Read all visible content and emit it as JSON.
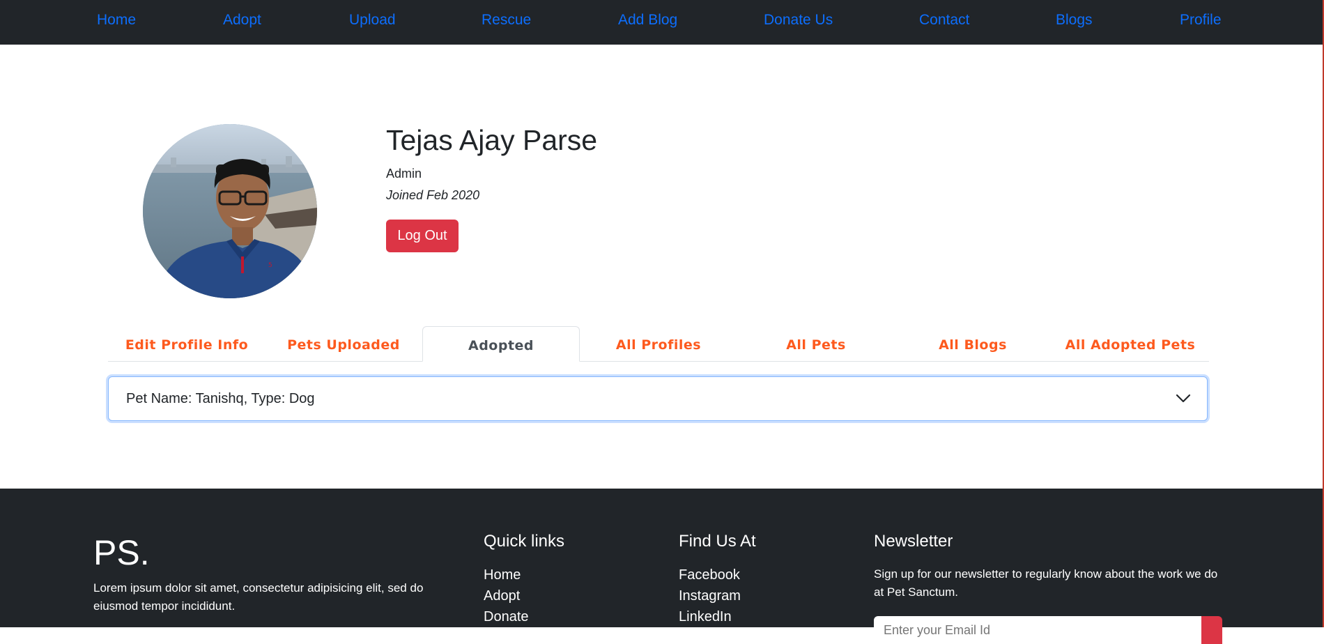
{
  "nav": {
    "items": [
      {
        "label": "Home"
      },
      {
        "label": "Adopt"
      },
      {
        "label": "Upload"
      },
      {
        "label": "Rescue"
      },
      {
        "label": "Add Blog"
      },
      {
        "label": "Donate Us"
      },
      {
        "label": "Contact"
      },
      {
        "label": "Blogs"
      },
      {
        "label": "Profile"
      }
    ],
    "link_color": "#0d6efd",
    "background": "#212529"
  },
  "profile": {
    "name": "Tejas Ajay Parse",
    "role": "Admin",
    "joined": "Joined Feb 2020",
    "logout_label": "Log Out"
  },
  "tabs": {
    "items": [
      {
        "label": "Edit Profile Info"
      },
      {
        "label": "Pets Uploaded"
      },
      {
        "label": "Adopted"
      },
      {
        "label": "All Profiles"
      },
      {
        "label": "All Pets"
      },
      {
        "label": "All Blogs"
      },
      {
        "label": "All Adopted Pets"
      }
    ],
    "active": "Adopted",
    "tab_color": "#fd5a1e"
  },
  "adopted": {
    "items": [
      {
        "summary": "Pet Name: Tanishq, Type: Dog",
        "icon": "chevron-down-icon"
      }
    ]
  },
  "footer": {
    "brand": "PS.",
    "description": "Lorem ipsum dolor sit amet, consectetur adipisicing elit, sed do eiusmod tempor incididunt.",
    "quick_links": {
      "title": "Quick links",
      "items": [
        {
          "label": "Home"
        },
        {
          "label": "Adopt"
        },
        {
          "label": "Donate"
        }
      ]
    },
    "find_us": {
      "title": "Find Us At",
      "items": [
        {
          "label": "Facebook"
        },
        {
          "label": "Instagram"
        },
        {
          "label": "LinkedIn"
        }
      ]
    },
    "newsletter": {
      "title": "Newsletter",
      "description": "Sign up for our newsletter to regularly know about the work we do at Pet Sanctum.",
      "email_placeholder": "Enter your Email Id"
    }
  },
  "colors": {
    "danger": "#dc3545",
    "dark": "#212529"
  }
}
